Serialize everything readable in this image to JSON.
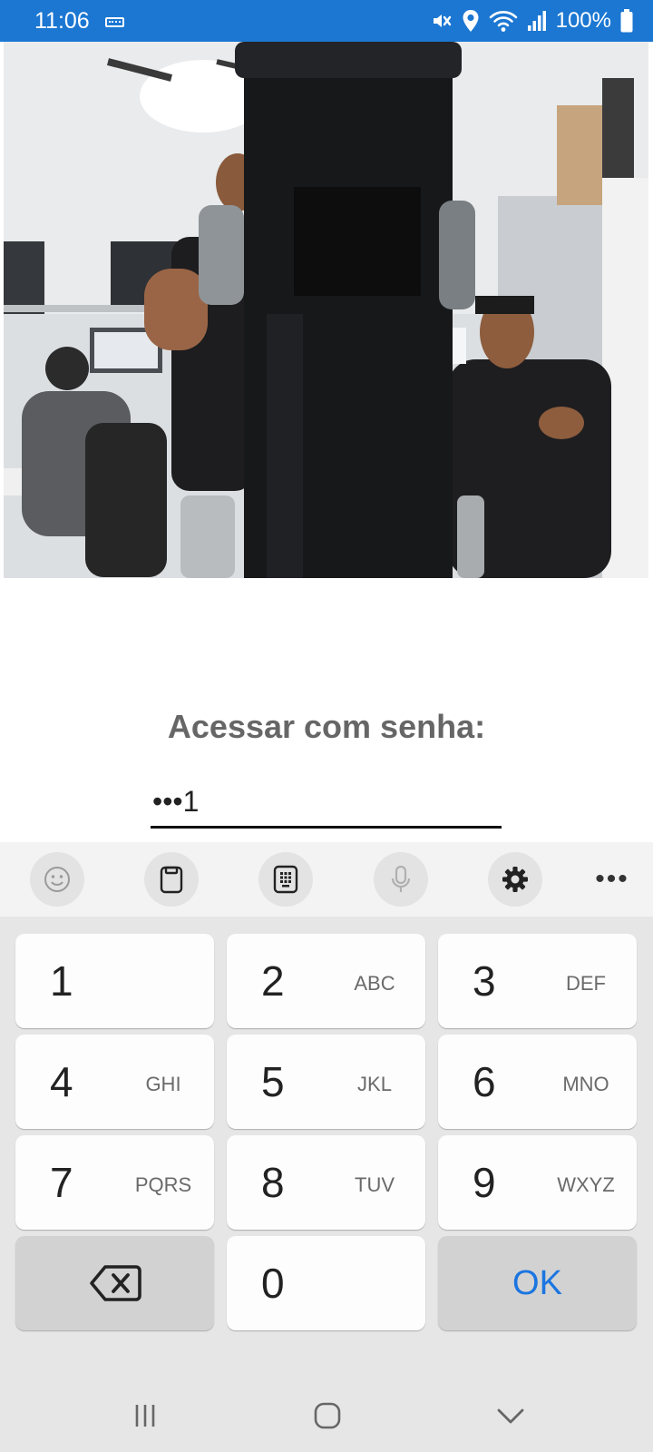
{
  "status_bar": {
    "time": "11:06",
    "battery_text": "100%",
    "background_color": "#1b77d2",
    "icons": [
      "keyboard-icon",
      "mute-icon",
      "location-icon",
      "wifi-icon",
      "signal-icon",
      "battery-icon"
    ]
  },
  "main": {
    "title": "Acessar com senha:",
    "password_value": "•••1"
  },
  "keyboard": {
    "toolbar": [
      "emoji-icon",
      "clipboard-icon",
      "keypad-icon",
      "mic-icon",
      "settings-icon",
      "more-icon"
    ],
    "more_label": "•••",
    "keys": [
      {
        "num": "1",
        "letters": ""
      },
      {
        "num": "2",
        "letters": "ABC"
      },
      {
        "num": "3",
        "letters": "DEF"
      },
      {
        "num": "4",
        "letters": "GHI"
      },
      {
        "num": "5",
        "letters": "JKL"
      },
      {
        "num": "6",
        "letters": "MNO"
      },
      {
        "num": "7",
        "letters": "PQRS"
      },
      {
        "num": "8",
        "letters": "TUV"
      },
      {
        "num": "9",
        "letters": "WXYZ"
      },
      {
        "num": "0",
        "letters": ""
      }
    ],
    "ok_label": "OK",
    "accent_color": "#1b75e0"
  },
  "nav_bar": [
    "recent-apps-icon",
    "home-icon",
    "back-icon"
  ]
}
